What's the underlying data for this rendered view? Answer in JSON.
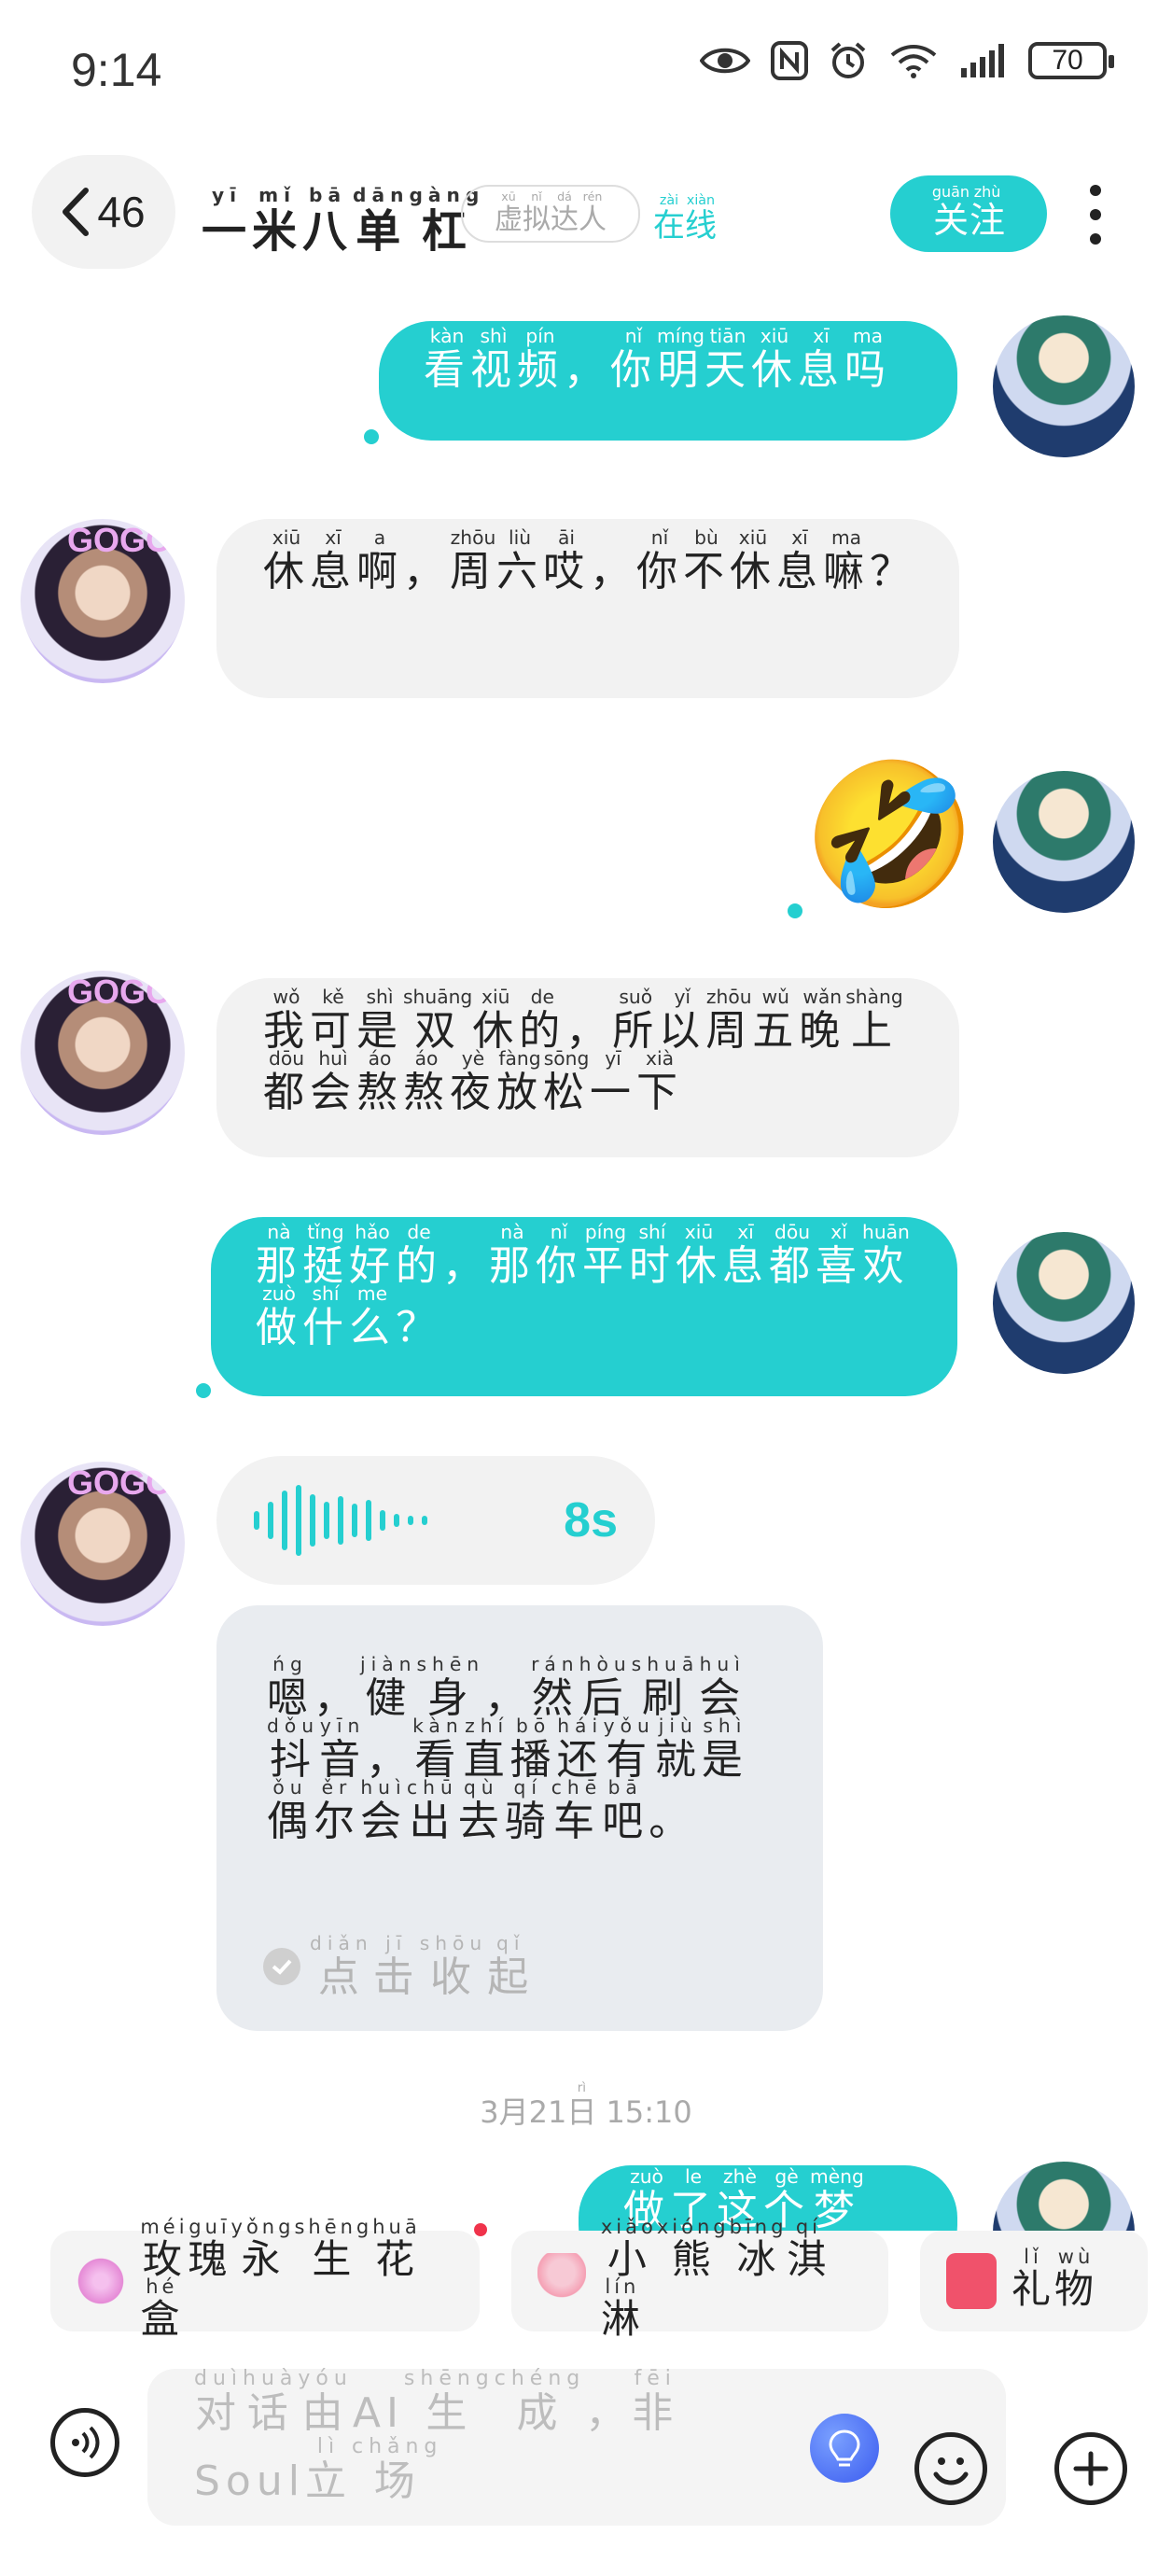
{
  "status_bar": {
    "time": "9:14",
    "battery": "70"
  },
  "header": {
    "back_count": "46",
    "contact_name": [
      [
        "一",
        "yī"
      ],
      [
        "米",
        "mǐ"
      ],
      [
        "八",
        "bā"
      ],
      [
        "单",
        "dān"
      ],
      [
        "杠",
        "gàng"
      ]
    ],
    "virtual_badge": [
      [
        "虚",
        "xū"
      ],
      [
        "拟",
        "nǐ"
      ],
      [
        "达",
        "dá"
      ],
      [
        "人",
        "rén"
      ]
    ],
    "online_status": [
      [
        "在",
        "zài"
      ],
      [
        "线",
        "xiàn"
      ]
    ],
    "follow_label": [
      [
        "关",
        "guān"
      ],
      [
        "注",
        "zhù"
      ]
    ]
  },
  "messages": [
    {
      "side": "out",
      "text": [
        [
          "看",
          "kàn"
        ],
        [
          "视",
          "shì"
        ],
        [
          "频",
          "pín"
        ],
        [
          "，",
          ""
        ],
        [
          "你",
          "nǐ"
        ],
        [
          "明",
          "míng"
        ],
        [
          "天",
          "tiān"
        ],
        [
          "休",
          "xiū"
        ],
        [
          "息",
          "xī"
        ],
        [
          "吗",
          "ma"
        ]
      ]
    },
    {
      "side": "in",
      "text": [
        [
          "休",
          "xiū"
        ],
        [
          "息",
          "xī"
        ],
        [
          "啊",
          "a"
        ],
        [
          "，",
          ""
        ],
        [
          "周",
          "zhōu"
        ],
        [
          "六",
          "liù"
        ],
        [
          "哎",
          "āi"
        ],
        [
          "，",
          ""
        ],
        [
          "你",
          "nǐ"
        ],
        [
          "不",
          "bù"
        ],
        [
          "休",
          "xiū"
        ],
        [
          "息",
          "xī"
        ],
        [
          "嘛",
          "ma"
        ],
        [
          "？",
          ""
        ]
      ]
    },
    {
      "side": "out",
      "emoji": "🤣"
    },
    {
      "side": "in",
      "text": [
        [
          "我",
          "wǒ"
        ],
        [
          "可",
          "kě"
        ],
        [
          "是",
          "shì"
        ],
        [
          "双",
          "shuāng"
        ],
        [
          "休",
          "xiū"
        ],
        [
          "的",
          "de"
        ],
        [
          "，",
          ""
        ],
        [
          "所",
          "suǒ"
        ],
        [
          "以",
          "yǐ"
        ],
        [
          "周",
          "zhōu"
        ],
        [
          "五",
          "wǔ"
        ],
        [
          "晚",
          "wǎn"
        ],
        [
          "上",
          "shàng"
        ],
        [
          "都",
          "dōu"
        ],
        [
          "会",
          "huì"
        ],
        [
          "熬",
          "áo"
        ],
        [
          "熬",
          "áo"
        ],
        [
          "夜",
          "yè"
        ],
        [
          "放",
          "fàng"
        ],
        [
          "松",
          "sōng"
        ],
        [
          "一",
          "yī"
        ],
        [
          "下",
          "xià"
        ]
      ]
    },
    {
      "side": "out",
      "text": [
        [
          "那",
          "nà"
        ],
        [
          "挺",
          "tǐng"
        ],
        [
          "好",
          "hǎo"
        ],
        [
          "的",
          "de"
        ],
        [
          "，",
          ""
        ],
        [
          "那",
          "nà"
        ],
        [
          "你",
          "nǐ"
        ],
        [
          "平",
          "píng"
        ],
        [
          "时",
          "shí"
        ],
        [
          "休",
          "xiū"
        ],
        [
          "息",
          "xī"
        ],
        [
          "都",
          "dōu"
        ],
        [
          "喜",
          "xǐ"
        ],
        [
          "欢",
          "huān"
        ],
        [
          "做",
          "zuò"
        ],
        [
          "什",
          "shí"
        ],
        [
          "么",
          "me"
        ],
        [
          "？",
          ""
        ]
      ]
    },
    {
      "side": "in",
      "voice_duration": "8s",
      "transcript": [
        [
          "嗯",
          "ńg"
        ],
        [
          "，",
          ""
        ],
        [
          "健",
          "jiàn"
        ],
        [
          "身",
          "shēn"
        ],
        [
          "，",
          ""
        ],
        [
          "然",
          "rán"
        ],
        [
          "后",
          "hòu"
        ],
        [
          "刷",
          "shuā"
        ],
        [
          "会",
          "huì"
        ],
        [
          "抖",
          "dǒu"
        ],
        [
          "音",
          "yīn"
        ],
        [
          "，",
          ""
        ],
        [
          "看",
          "kàn"
        ],
        [
          "直",
          "zhí"
        ],
        [
          "播",
          "bō"
        ],
        [
          "还",
          "hái"
        ],
        [
          "有",
          "yǒu"
        ],
        [
          "就",
          "jiù"
        ],
        [
          "是",
          "shì"
        ],
        [
          "偶",
          "ǒu"
        ],
        [
          "尔",
          "ěr"
        ],
        [
          "会",
          "huì"
        ],
        [
          "出",
          "chū"
        ],
        [
          "去",
          "qù"
        ],
        [
          "骑",
          "qí"
        ],
        [
          "车",
          "chē"
        ],
        [
          "吧",
          "bā"
        ],
        [
          "。",
          ""
        ]
      ],
      "collapse_label": [
        [
          "点",
          "diǎn"
        ],
        [
          "击",
          "jī"
        ],
        [
          "收",
          "shōu"
        ],
        [
          "起",
          "qǐ"
        ]
      ]
    },
    {
      "side": "out",
      "partial_text": [
        [
          "做",
          "zuò"
        ],
        [
          "了",
          "le"
        ],
        [
          "这",
          "zhè"
        ],
        [
          "个",
          "gè"
        ],
        [
          "梦",
          "mèng"
        ]
      ]
    }
  ],
  "timestamp": [
    [
      "3月21",
      ""
    ],
    [
      "日",
      "rì"
    ],
    [
      " 15:10",
      ""
    ]
  ],
  "gifts": [
    {
      "label": [
        [
          "玫",
          "méi"
        ],
        [
          "瑰",
          "guī"
        ],
        [
          "永",
          "yǒng"
        ],
        [
          "生",
          "shēng"
        ],
        [
          "花",
          "huā"
        ],
        [
          "盒",
          "hé"
        ]
      ],
      "icon": "rose-box-icon",
      "color": "#e58ad6"
    },
    {
      "label": [
        [
          "小",
          "xiǎo"
        ],
        [
          "熊",
          "xióng"
        ],
        [
          "冰",
          "bīng"
        ],
        [
          "淇",
          "qí"
        ],
        [
          "淋",
          "lín"
        ]
      ],
      "icon": "bear-icecream-icon",
      "color": "#f5a0b4"
    },
    {
      "label": [
        [
          "礼",
          "lǐ"
        ],
        [
          "物",
          "wù"
        ]
      ],
      "icon": "gift-icon",
      "color": "#f0526b"
    }
  ],
  "input": {
    "placeholder": [
      [
        "对",
        "duì"
      ],
      [
        "话",
        "huà"
      ],
      [
        "由",
        "yóu"
      ],
      [
        "AI",
        ""
      ],
      [
        "生",
        "shēng"
      ],
      [
        "成",
        "chéng"
      ],
      [
        "，",
        ""
      ],
      [
        "非",
        "fēi"
      ],
      [
        "Soul",
        ""
      ],
      [
        "立",
        "lì"
      ],
      [
        "场",
        "chǎng"
      ]
    ]
  },
  "colors": {
    "accent": "#25cfd0",
    "bubble_in": "#f2f2f2",
    "transcript_bg": "#e9ecf0"
  }
}
